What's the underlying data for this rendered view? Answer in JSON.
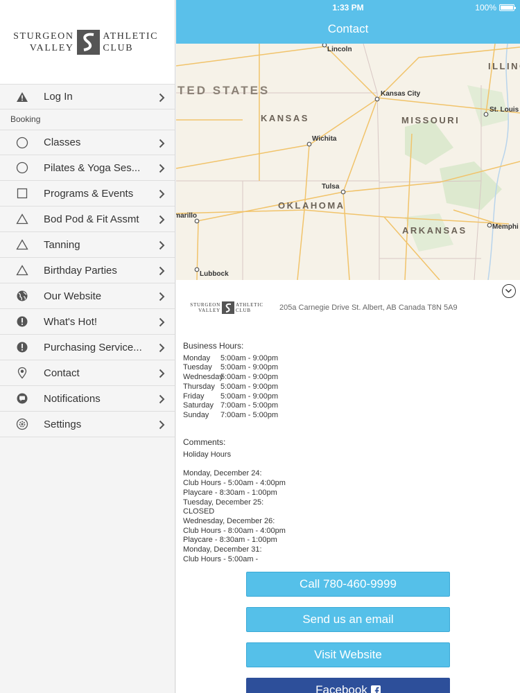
{
  "status_bar": {
    "time": "1:33 PM",
    "battery": "100%"
  },
  "nav_bar": {
    "title": "Contact"
  },
  "logo": {
    "left_line1": "STURGEON",
    "left_line2": "VALLEY",
    "right_line1": "ATHLETIC",
    "right_line2": "CLUB"
  },
  "menu": {
    "login": {
      "label": "Log In",
      "icon": "warning-icon"
    },
    "section_booking": "Booking",
    "items": [
      {
        "label": "Classes",
        "icon": "circle-icon"
      },
      {
        "label": "Pilates & Yoga Ses...",
        "icon": "circle-icon"
      },
      {
        "label": "Programs & Events",
        "icon": "square-icon"
      },
      {
        "label": "Bod Pod & Fit Assmt",
        "icon": "triangle-icon"
      },
      {
        "label": "Tanning",
        "icon": "triangle-icon"
      },
      {
        "label": "Birthday Parties",
        "icon": "triangle-icon"
      },
      {
        "label": "Our Website",
        "icon": "globe-icon"
      },
      {
        "label": "What's Hot!",
        "icon": "exclamation-icon"
      },
      {
        "label": "Purchasing Service...",
        "icon": "exclamation-icon"
      },
      {
        "label": "Contact",
        "icon": "pin-icon"
      },
      {
        "label": "Notifications",
        "icon": "chat-icon"
      },
      {
        "label": "Settings",
        "icon": "gear-icon"
      }
    ]
  },
  "map": {
    "country": "TED STATES",
    "states": [
      "KANSAS",
      "MISSOURI",
      "OKLAHOMA",
      "ARKANSAS",
      "ILLINO"
    ],
    "cities": [
      "Lincoln",
      "Kansas City",
      "St. Louis",
      "Wichita",
      "Tulsa",
      "Amarillo",
      "Lubbock",
      "Memphi"
    ]
  },
  "contact": {
    "logo": {
      "left_line1": "STURGEON",
      "left_line2": "VALLEY",
      "right_line1": "ATHLETIC",
      "right_line2": "CLUB"
    },
    "address": "205a Carnegie Drive  St. Albert, AB  Canada T8N 5A9",
    "hours_title": "Business Hours:",
    "hours": [
      {
        "day": "Monday",
        "time": "5:00am - 9:00pm"
      },
      {
        "day": "Tuesday",
        "time": "5:00am - 9:00pm"
      },
      {
        "day": "Wednesday",
        "time": "5:00am - 9:00pm"
      },
      {
        "day": "Thursday",
        "time": "5:00am - 9:00pm"
      },
      {
        "day": "Friday",
        "time": "5:00am - 9:00pm"
      },
      {
        "day": "Saturday",
        "time": "7:00am - 5:00pm"
      },
      {
        "day": "Sunday",
        "time": "7:00am - 5:00pm"
      }
    ],
    "comments_title": "Comments:",
    "comments_subtitle": "Holiday Hours",
    "comments": [
      "Monday, December 24:",
      "Club Hours - 5:00am - 4:00pm",
      "Playcare - 8:30am - 1:00pm",
      "Tuesday, December 25:",
      "CLOSED",
      "Wednesday, December 26:",
      "Club Hours - 8:00am - 4:00pm",
      "Playcare - 8:30am - 1:00pm",
      "Monday, December 31:",
      "Club Hours - 5:00am -"
    ],
    "buttons": {
      "call": "Call 780-460-9999",
      "email": "Send us an email",
      "website": "Visit Website",
      "facebook": "Facebook"
    }
  },
  "colors": {
    "nav_blue": "#5ac0ea",
    "button_blue": "#55c0e9",
    "facebook_blue": "#2d4f9a"
  }
}
